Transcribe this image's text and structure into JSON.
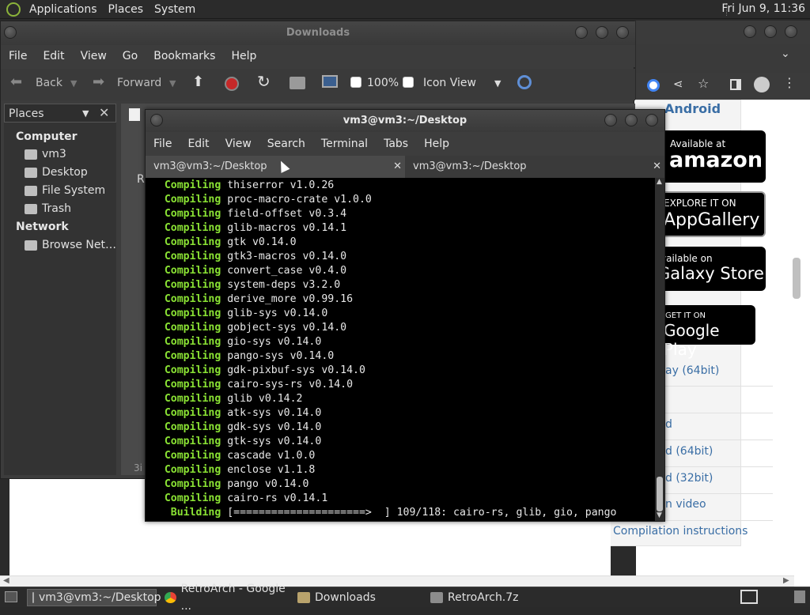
{
  "top_panel": {
    "menus": [
      "Applications",
      "Places",
      "System"
    ],
    "clock": "Fri Jun 9, 11:36"
  },
  "file_manager": {
    "title": "Downloads",
    "menus": [
      "File",
      "Edit",
      "View",
      "Go",
      "Bookmarks",
      "Help"
    ],
    "toolbar": {
      "back": "Back",
      "forward": "Forward",
      "zoom": "100%",
      "view_mode": "Icon View"
    },
    "places_label": "Places",
    "sidebar": {
      "computer_heading": "Computer",
      "computer_items": [
        "vm3",
        "Desktop",
        "File System",
        "Trash"
      ],
      "network_heading": "Network",
      "network_items": [
        "Browse Net…"
      ]
    },
    "content_letter": "R",
    "status": "3i"
  },
  "terminal": {
    "title": "vm3@vm3:~/Desktop",
    "menus": [
      "File",
      "Edit",
      "View",
      "Search",
      "Terminal",
      "Tabs",
      "Help"
    ],
    "tabs": [
      "vm3@vm3:~/Desktop",
      "vm3@vm3:~/Desktop"
    ],
    "lines": [
      {
        "kw": "Compiling",
        "text": "thiserror v1.0.26"
      },
      {
        "kw": "Compiling",
        "text": "proc-macro-crate v1.0.0"
      },
      {
        "kw": "Compiling",
        "text": "field-offset v0.3.4"
      },
      {
        "kw": "Compiling",
        "text": "glib-macros v0.14.1"
      },
      {
        "kw": "Compiling",
        "text": "gtk v0.14.0"
      },
      {
        "kw": "Compiling",
        "text": "gtk3-macros v0.14.0"
      },
      {
        "kw": "Compiling",
        "text": "convert_case v0.4.0"
      },
      {
        "kw": "Compiling",
        "text": "system-deps v3.2.0"
      },
      {
        "kw": "Compiling",
        "text": "derive_more v0.99.16"
      },
      {
        "kw": "Compiling",
        "text": "glib-sys v0.14.0"
      },
      {
        "kw": "Compiling",
        "text": "gobject-sys v0.14.0"
      },
      {
        "kw": "Compiling",
        "text": "gio-sys v0.14.0"
      },
      {
        "kw": "Compiling",
        "text": "pango-sys v0.14.0"
      },
      {
        "kw": "Compiling",
        "text": "gdk-pixbuf-sys v0.14.0"
      },
      {
        "kw": "Compiling",
        "text": "cairo-sys-rs v0.14.0"
      },
      {
        "kw": "Compiling",
        "text": "glib v0.14.2"
      },
      {
        "kw": "Compiling",
        "text": "atk-sys v0.14.0"
      },
      {
        "kw": "Compiling",
        "text": "gdk-sys v0.14.0"
      },
      {
        "kw": "Compiling",
        "text": "gtk-sys v0.14.0"
      },
      {
        "kw": "Compiling",
        "text": "cascade v1.0.0"
      },
      {
        "kw": "Compiling",
        "text": "enclose v1.1.8"
      },
      {
        "kw": "Compiling",
        "text": "pango v0.14.0"
      },
      {
        "kw": "Compiling",
        "text": "cairo-rs v0.14.1"
      },
      {
        "kw": " Building",
        "text": "[=====================>  ] 109/118: cairo-rs, glib, gio, pango"
      }
    ]
  },
  "browser": {
    "heading": "Android",
    "badges": [
      {
        "small": "Available at",
        "big": "amazon"
      },
      {
        "small": "EXPLORE IT ON",
        "big": "AppGallery"
      },
      {
        "small": "vailable on",
        "big": "Galaxy Store"
      },
      {
        "small": "GET IT ON",
        "big": "Google Play"
      }
    ],
    "links": [
      "ay (64bit)",
      "d",
      "d (64bit)",
      "d (32bit)",
      "n video",
      "Compilation instructions"
    ]
  },
  "taskbar": {
    "tasks": [
      "vm3@vm3:~/Desktop",
      "RetroArch - Google ...",
      "Downloads",
      "RetroArch.7z"
    ]
  }
}
